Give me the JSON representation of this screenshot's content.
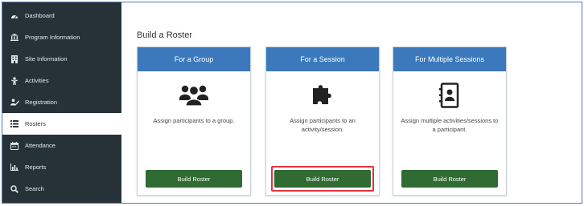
{
  "sidebar": {
    "items": [
      {
        "label": "Dashboard",
        "icon": "dashboard-icon",
        "active": false
      },
      {
        "label": "Program Information",
        "icon": "institution-icon",
        "active": false
      },
      {
        "label": "Site Information",
        "icon": "building-icon",
        "active": false
      },
      {
        "label": "Activities",
        "icon": "child-icon",
        "active": false
      },
      {
        "label": "Registration",
        "icon": "registration-icon",
        "active": false
      },
      {
        "label": "Rosters",
        "icon": "list-icon",
        "active": true
      },
      {
        "label": "Attendance",
        "icon": "calendar-icon",
        "active": false
      },
      {
        "label": "Reports",
        "icon": "bar-chart-icon",
        "active": false
      },
      {
        "label": "Search",
        "icon": "search-icon",
        "active": false
      }
    ]
  },
  "main": {
    "title": "Build a Roster",
    "cards": [
      {
        "header": "For a Group",
        "icon": "users-icon",
        "description": "Assign participants to a group.",
        "button": "Build Roster",
        "highlighted": false
      },
      {
        "header": "For a Session",
        "icon": "puzzle-piece-icon",
        "description": "Assign participants to an activity/session.",
        "button": "Build Roster",
        "highlighted": true
      },
      {
        "header": "For Multiple Sessions",
        "icon": "address-book-icon",
        "description": "Assign multiple activities/sessions to a participant.",
        "button": "Build Roster",
        "highlighted": false
      }
    ]
  },
  "colors": {
    "sidebar_bg": "#263238",
    "card_header": "#3b79bc",
    "button": "#2f6b32",
    "highlight": "#e5323b"
  }
}
